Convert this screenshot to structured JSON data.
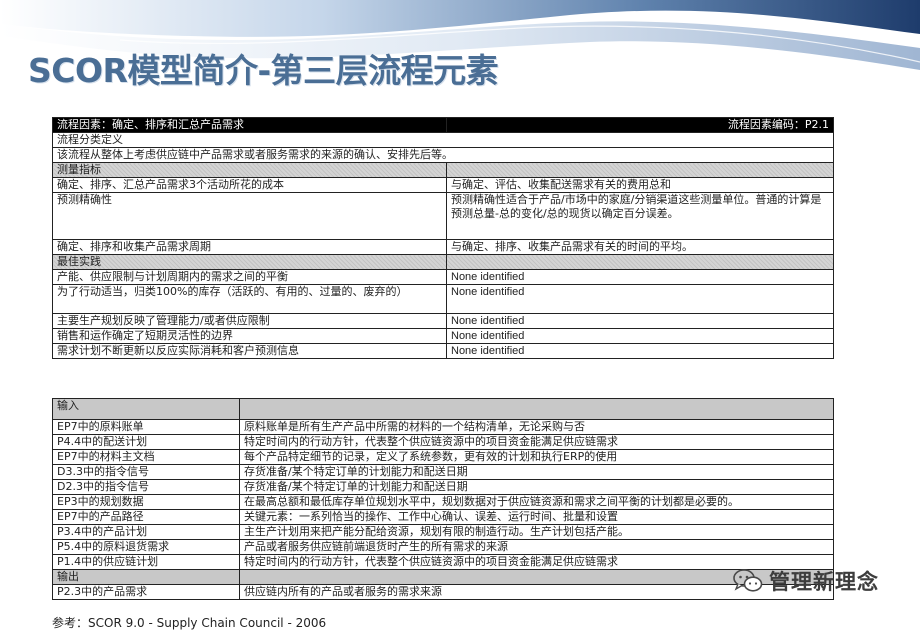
{
  "title": "SCOR模型简介-第三层流程元素",
  "colors": {
    "title": "#4a6e95",
    "banner_dark": "#1e3c6c",
    "banner_light": "#b9cde6"
  },
  "table1": {
    "header_left": "流程因素：确定、排序和汇总产品需求",
    "header_right": "流程因素编码：P2.1",
    "def_label": "流程分类定义",
    "def_text": "该流程从整体上考虑供应链中产品需求或者服务需求的来源的确认、安排先后等。",
    "metrics_label": "测量指标",
    "metrics": [
      {
        "left": "确定、排序、汇总产品需求3个活动所花的成本",
        "right": "与确定、评估、收集配送需求有关的费用总和"
      },
      {
        "left": "预测精确性",
        "right": "预测精确性适合于产品/市场中的家庭/分销渠道这些测量单位。普通的计算是预测总量-总的变化/总的现货以确定百分误差。"
      },
      {
        "left": "确定、排序和收集产品需求周期",
        "right": "与确定、排序、收集产品需求有关的时间的平均。"
      }
    ],
    "best_label": "最佳实践",
    "practices": [
      {
        "left": "产能、供应限制与计划周期内的需求之间的平衡",
        "right": "None identified"
      },
      {
        "left": "为了行动适当，归类100%的库存（活跃的、有用的、过量的、废弃的）",
        "right": "None identified"
      },
      {
        "left": "主要生产规划反映了管理能力/或者供应限制",
        "right": "None identified"
      },
      {
        "left": "销售和运作确定了短期灵活性的边界",
        "right": "None identified"
      },
      {
        "left": "需求计划不断更新以反应实际消耗和客户预测信息",
        "right": "None identified"
      }
    ]
  },
  "table2": {
    "input_label": "输入",
    "inputs": [
      {
        "left": "EP7中的原料账单",
        "right": "原料账单是所有生产产品中所需的材料的一个结构清单，无论采购与否"
      },
      {
        "left": "P4.4中的配送计划",
        "right": "特定时间内的行动方针，代表整个供应链资源中的项目资金能满足供应链需求"
      },
      {
        "left": "EP7中的材料主文档",
        "right": "每个产品特定细节的记录，定义了系统参数，更有效的计划和执行ERP的使用"
      },
      {
        "left": "D3.3中的指令信号",
        "right": "存货准备/某个特定订单的计划能力和配送日期"
      },
      {
        "left": "D2.3中的指令信号",
        "right": "存货准备/某个特定订单的计划能力和配送日期"
      },
      {
        "left": "EP3中的规划数据",
        "right": "在最高总额和最低库存单位规划水平中，规划数据对于供应链资源和需求之间平衡的计划都是必要的。"
      },
      {
        "left": "EP7中的产品路径",
        "right": "关键元素：一系列恰当的操作、工作中心确认、误差、运行时间、批量和设置"
      },
      {
        "left": "P3.4中的产品计划",
        "right": "主生产计划用来把产能分配给资源，规划有限的制造行动。生产计划包括产能。"
      },
      {
        "left": "P5.4中的原料退货需求",
        "right": "产品或者服务供应链前端退货时产生的所有需求的来源"
      },
      {
        "left": "P1.4中的供应链计划",
        "right": "特定时间内的行动方针，代表整个供应链资源中的项目资金能满足供应链需求"
      }
    ],
    "output_label": "输出",
    "outputs": [
      {
        "left": "P2.3中的产品需求",
        "right": "供应链内所有的产品或者服务的需求来源"
      }
    ]
  },
  "watermark": {
    "text": "管理新理念",
    "icon": "wechat-icon"
  },
  "footnote": "参考：SCOR 9.0 - Supply Chain Council - 2006"
}
